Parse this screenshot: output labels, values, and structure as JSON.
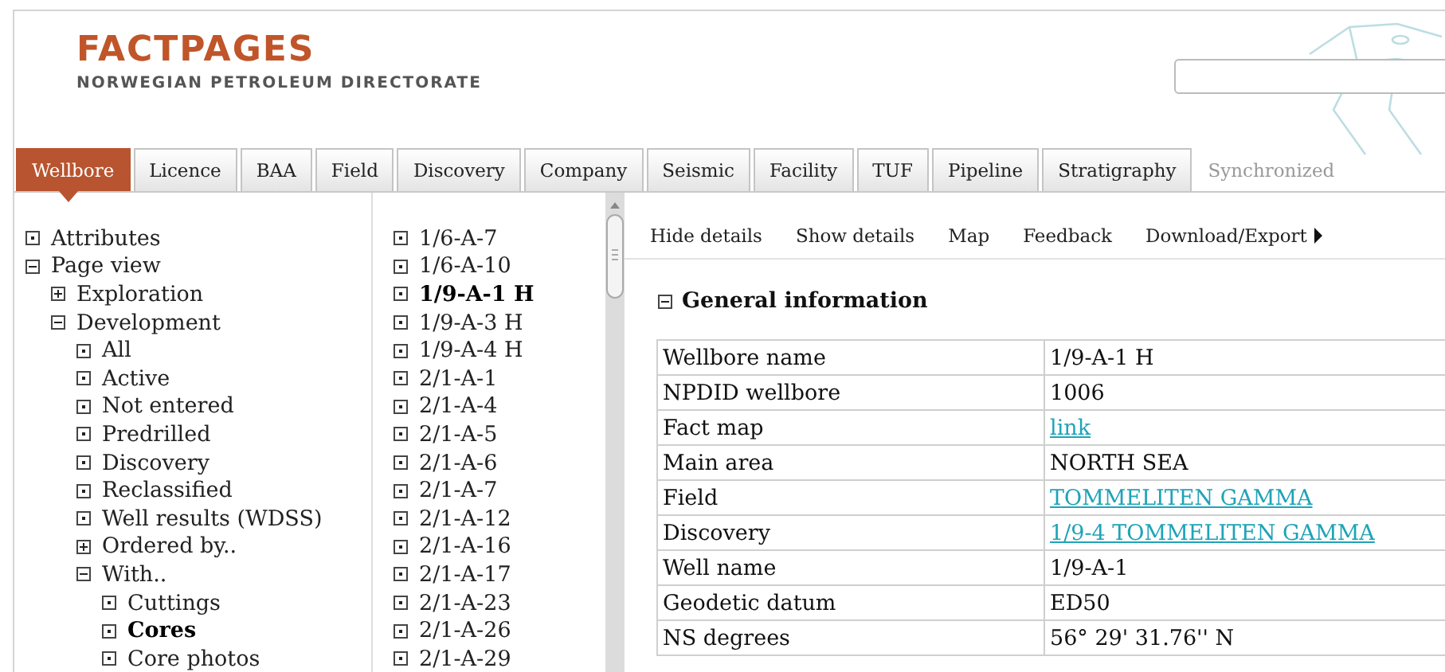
{
  "header": {
    "logo_title": "FACTPAGES",
    "logo_subtitle": "NORWEGIAN PETROLEUM DIRECTORATE"
  },
  "tabs": [
    {
      "label": "Wellbore",
      "selected": true
    },
    {
      "label": "Licence",
      "selected": false
    },
    {
      "label": "BAA",
      "selected": false
    },
    {
      "label": "Field",
      "selected": false
    },
    {
      "label": "Discovery",
      "selected": false
    },
    {
      "label": "Company",
      "selected": false
    },
    {
      "label": "Seismic",
      "selected": false
    },
    {
      "label": "Facility",
      "selected": false
    },
    {
      "label": "TUF",
      "selected": false
    },
    {
      "label": "Pipeline",
      "selected": false
    },
    {
      "label": "Stratigraphy",
      "selected": false
    }
  ],
  "sync_label": "Synchronized",
  "tree": [
    {
      "label": "Attributes",
      "kind": "leaf",
      "selected": false
    },
    {
      "label": "Page view",
      "kind": "branch",
      "expanded": true,
      "selected": false,
      "children": [
        {
          "label": "Exploration",
          "kind": "branch",
          "expanded": false,
          "selected": false
        },
        {
          "label": "Development",
          "kind": "branch",
          "expanded": true,
          "selected": false,
          "children": [
            {
              "label": "All",
              "kind": "leaf",
              "selected": false
            },
            {
              "label": "Active",
              "kind": "leaf",
              "selected": false
            },
            {
              "label": "Not entered",
              "kind": "leaf",
              "selected": false
            },
            {
              "label": "Predrilled",
              "kind": "leaf",
              "selected": false
            },
            {
              "label": "Discovery",
              "kind": "leaf",
              "selected": false
            },
            {
              "label": "Reclassified",
              "kind": "leaf",
              "selected": false
            },
            {
              "label": "Well results (WDSS)",
              "kind": "leaf",
              "selected": false
            },
            {
              "label": "Ordered by..",
              "kind": "branch",
              "expanded": false,
              "selected": false
            },
            {
              "label": "With..",
              "kind": "branch",
              "expanded": true,
              "selected": false,
              "children": [
                {
                  "label": "Cuttings",
                  "kind": "leaf",
                  "selected": false
                },
                {
                  "label": "Cores",
                  "kind": "leaf",
                  "selected": true
                },
                {
                  "label": "Core photos",
                  "kind": "leaf",
                  "selected": false
                }
              ]
            }
          ]
        }
      ]
    }
  ],
  "wellbores": [
    {
      "label": "1/6-A-7",
      "selected": false
    },
    {
      "label": "1/6-A-10",
      "selected": false
    },
    {
      "label": "1/9-A-1 H",
      "selected": true
    },
    {
      "label": "1/9-A-3 H",
      "selected": false
    },
    {
      "label": "1/9-A-4 H",
      "selected": false
    },
    {
      "label": "2/1-A-1",
      "selected": false
    },
    {
      "label": "2/1-A-4",
      "selected": false
    },
    {
      "label": "2/1-A-5",
      "selected": false
    },
    {
      "label": "2/1-A-6",
      "selected": false
    },
    {
      "label": "2/1-A-7",
      "selected": false
    },
    {
      "label": "2/1-A-12",
      "selected": false
    },
    {
      "label": "2/1-A-16",
      "selected": false
    },
    {
      "label": "2/1-A-17",
      "selected": false
    },
    {
      "label": "2/1-A-23",
      "selected": false
    },
    {
      "label": "2/1-A-26",
      "selected": false
    },
    {
      "label": "2/1-A-29",
      "selected": false
    }
  ],
  "toolbar": [
    {
      "label": "Hide details",
      "kind": "link"
    },
    {
      "label": "Show details",
      "kind": "link"
    },
    {
      "label": "Map",
      "kind": "link"
    },
    {
      "label": "Feedback",
      "kind": "link"
    },
    {
      "label": "Download/Export",
      "kind": "menu"
    }
  ],
  "section": {
    "title": "General information",
    "expanded": true
  },
  "table": {
    "rows": [
      {
        "label": "Wellbore name",
        "value": "1/9-A-1 H",
        "kind": "text"
      },
      {
        "label": "NPDID wellbore",
        "value": "1006",
        "kind": "text"
      },
      {
        "label": "Fact map",
        "value": "link",
        "kind": "link"
      },
      {
        "label": "Main area",
        "value": "NORTH SEA",
        "kind": "text"
      },
      {
        "label": "Field",
        "value": "TOMMELITEN GAMMA",
        "kind": "link"
      },
      {
        "label": "Discovery",
        "value": "1/9-4 TOMMELITEN GAMMA",
        "kind": "link"
      },
      {
        "label": "Well name",
        "value": "1/9-A-1",
        "kind": "text"
      },
      {
        "label": "Geodetic datum",
        "value": "ED50",
        "kind": "text"
      },
      {
        "label": "NS degrees",
        "value": "56° 29' 31.76'' N",
        "kind": "text"
      }
    ]
  }
}
